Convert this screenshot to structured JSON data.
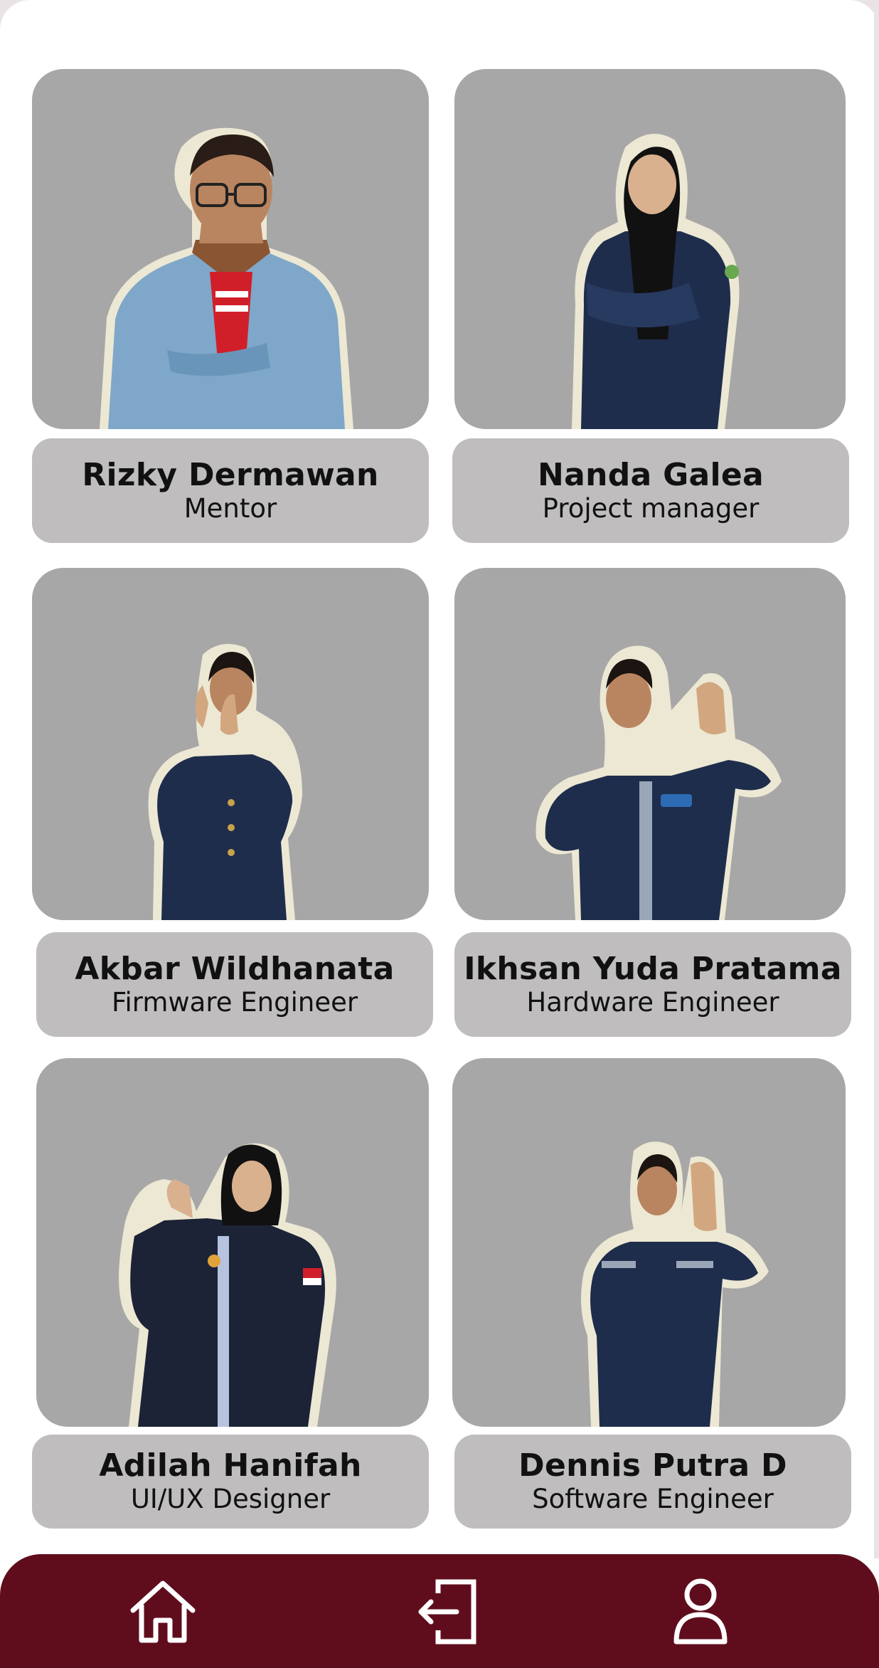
{
  "team": [
    {
      "name": "Rizky Dermawan",
      "role": "Mentor"
    },
    {
      "name": "Nanda Galea",
      "role": "Project manager"
    },
    {
      "name": "Akbar Wildhanata",
      "role": "Firmware Engineer"
    },
    {
      "name": "Ikhsan Yuda Pratama",
      "role": "Hardware Engineer"
    },
    {
      "name": "Adilah Hanifah",
      "role": "UI/UX Designer"
    },
    {
      "name": "Dennis Putra D",
      "role": "Software Engineer"
    }
  ],
  "nav": {
    "items": [
      {
        "icon": "home-icon"
      },
      {
        "icon": "logout-icon"
      },
      {
        "icon": "profile-icon"
      }
    ]
  },
  "colors": {
    "nav_background": "#5f0d1d",
    "photo_background": "#a7a7a7",
    "caption_background": "#bfbdbd",
    "outline": "#ece8d4",
    "jacket_denim": "#7fa7c9",
    "jacket_navy": "#1f2d4c"
  }
}
